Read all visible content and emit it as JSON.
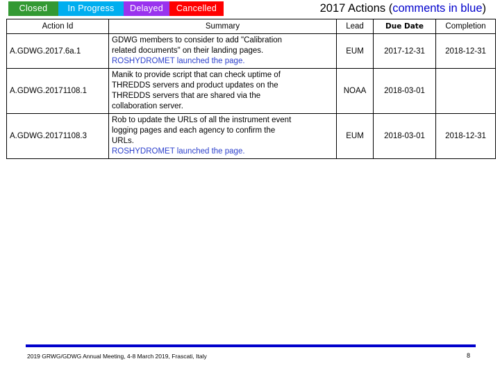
{
  "legend": {
    "tabs": [
      {
        "label": "Closed",
        "status": "closed",
        "color": "#339933"
      },
      {
        "label": "In Progress",
        "status": "inprogress",
        "color": "#00AEEF"
      },
      {
        "label": "Delayed",
        "status": "delayed",
        "color": "#9933EE"
      },
      {
        "label": "Cancelled",
        "status": "cancelled",
        "color": "#FF0000"
      }
    ]
  },
  "title": {
    "main": "2017 Actions ",
    "paren_open": "(",
    "note": "comments in blue",
    "paren_close": ")",
    "note_color": "#0000CC"
  },
  "table": {
    "headers": {
      "action_id": "Action Id",
      "summary": "Summary",
      "lead": "Lead",
      "due_date": "Due Date",
      "completion": "Completion"
    },
    "rows": [
      {
        "action_id": "A.GDWG.2017.6a.1",
        "status": "closed",
        "summary_lines": [
          {
            "text": "GDWG members to consider to add \"Calibration",
            "blue": false
          },
          {
            "text": "related documents\" on their landing pages.",
            "blue": false
          },
          {
            "text": "ROSHYDROMET launched the page.",
            "blue": true
          }
        ],
        "lead": "EUM",
        "due_date": "2017-12-31",
        "completion": "2018-12-31"
      },
      {
        "action_id": "A.GDWG.20171108.1",
        "status": "inprogress",
        "summary_lines": [
          {
            "text": "Manik to provide script that can check uptime of",
            "blue": false
          },
          {
            "text": "THREDDS servers and product updates on the",
            "blue": false
          },
          {
            "text": "THREDDS servers that are shared via the",
            "blue": false
          },
          {
            "text": "collaboration server.",
            "blue": false
          }
        ],
        "lead": "NOAA",
        "due_date": "2018-03-01",
        "completion": ""
      },
      {
        "action_id": "A.GDWG.20171108.3",
        "status": "closed",
        "summary_lines": [
          {
            "text": "Rob to update the URLs of all the instrument event",
            "blue": false
          },
          {
            "text": "logging pages and each agency to confirm the",
            "blue": false
          },
          {
            "text": "URLs.",
            "blue": false
          },
          {
            "text": "ROSHYDROMET launched the page.",
            "blue": true
          }
        ],
        "lead": "EUM",
        "due_date": "2018-03-01",
        "completion": "2018-12-31"
      }
    ]
  },
  "footer": {
    "text": "2019 GRWG/GDWG Annual Meeting, 4-8 March 2019, Frascati, Italy",
    "page_number": "8",
    "rule_color": "#0000CC"
  }
}
